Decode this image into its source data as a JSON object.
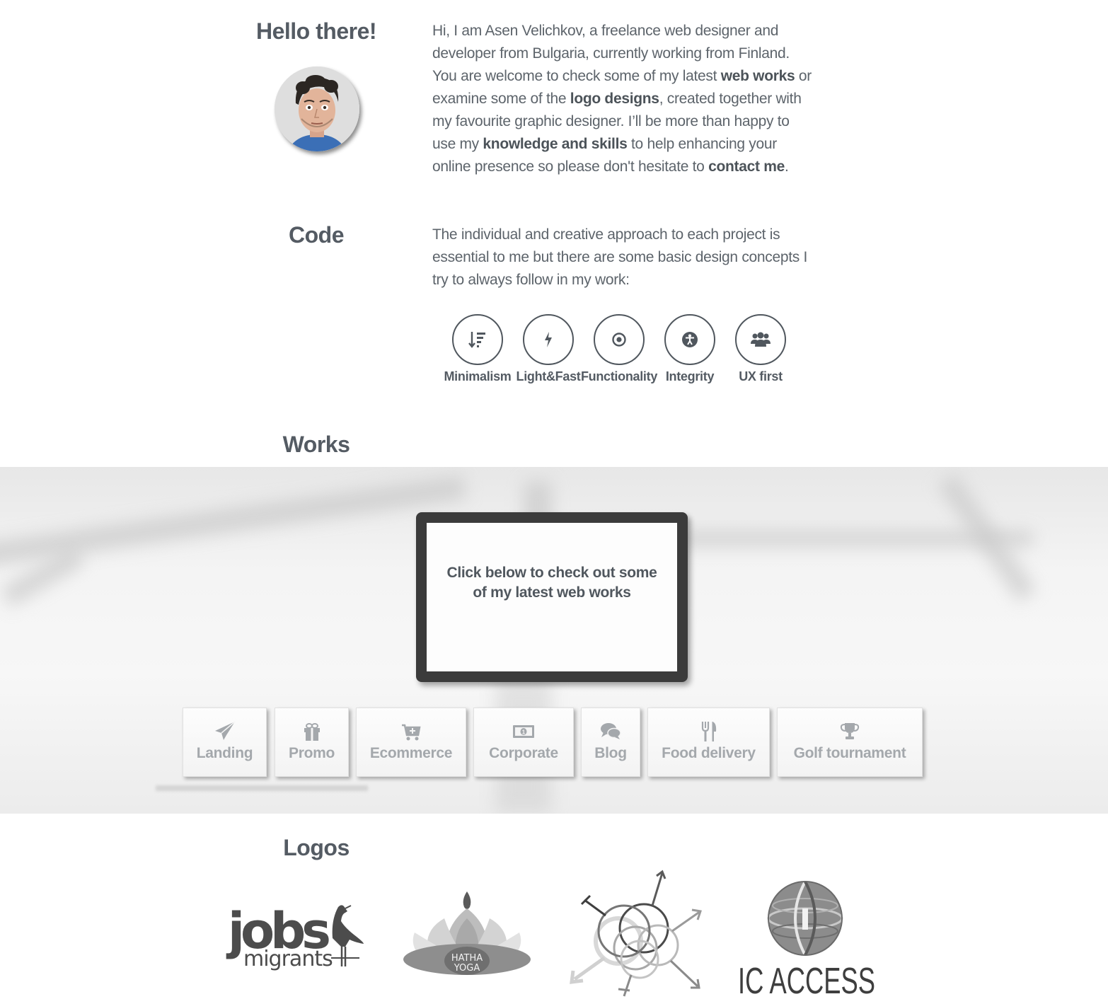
{
  "about": {
    "heading": "Hello there!",
    "avatar_alt": "Asen Velichkov portrait",
    "p1": "Hi, I am Asen Velichkov, a freelance web designer and developer from Bulgaria, currently working from Finland. You are welcome to check some of my latest ",
    "link_web_works": "web works",
    "p2": " or examine some of the ",
    "link_logo_designs": "logo designs",
    "p3": ", created together with my favourite graphic designer. I’ll be more than happy to use my ",
    "link_skills": "knowledge and skills",
    "p4": " to help enhancing your online presence so please don't hesitate to ",
    "link_contact": "contact me",
    "p5": "."
  },
  "code": {
    "heading": "Code",
    "text": "The individual and creative approach to each project is essential to me but there are some basic design concepts I try to always follow in my work:",
    "principles": [
      {
        "label": "Minimalism",
        "icon": "sort-amount-icon"
      },
      {
        "label": "Light&Fast",
        "icon": "bolt-icon"
      },
      {
        "label": "Functionality",
        "icon": "dot-circle-icon"
      },
      {
        "label": "Integrity",
        "icon": "accessibility-icon"
      },
      {
        "label": "UX first",
        "icon": "users-icon"
      }
    ]
  },
  "works": {
    "heading": "Works",
    "screen_text": "Click below to check out some of my latest web works",
    "buttons": [
      {
        "label": "Landing",
        "icon": "paper-plane-icon"
      },
      {
        "label": "Promo",
        "icon": "gift-icon"
      },
      {
        "label": "Ecommerce",
        "icon": "cart-plus-icon"
      },
      {
        "label": "Corporate",
        "icon": "money-bill-icon"
      },
      {
        "label": "Blog",
        "icon": "comments-icon"
      },
      {
        "label": "Food delivery",
        "icon": "cutlery-icon"
      },
      {
        "label": "Golf tournament",
        "icon": "trophy-icon"
      }
    ]
  },
  "logos": {
    "heading": "Logos",
    "items": [
      {
        "name": "jobs4migrants",
        "text_main": "jobs",
        "text_sub": "migrants"
      },
      {
        "name": "hatha-yoga",
        "line1": "HATHA",
        "line2": "YOGA"
      },
      {
        "name": "gender-circles"
      },
      {
        "name": "ic-access",
        "text": "IC ACCESS"
      }
    ]
  },
  "colors": {
    "text": "#5d646b",
    "heading": "#545b63",
    "button_label": "#a4a8ac",
    "monitor_frame": "#3b3b3b"
  }
}
